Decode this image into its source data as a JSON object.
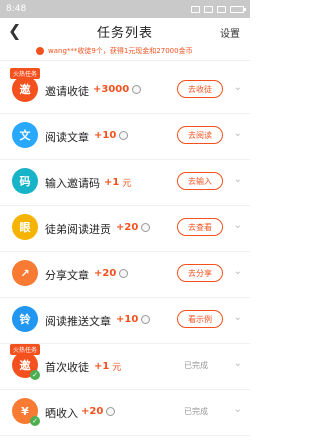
{
  "statusbar": {
    "time": "8:48"
  },
  "nav": {
    "back_icon": "back-icon",
    "title": "任务列表",
    "settings": "设置"
  },
  "ticker": {
    "text": "wang***收徒9个，获得1元现金和27000金币"
  },
  "colors": {
    "accent": "#f4511e",
    "blue": "#29a8ff",
    "teal": "#17b3c9",
    "yellow": "#f6b400",
    "orange": "#f97a33",
    "sky": "#2196f3"
  },
  "tasks": [
    {
      "label": "邀请收徒",
      "reward": "+3000",
      "unit": "",
      "coin": true,
      "action": "去收徒",
      "hot": "火热任务",
      "done": ""
    },
    {
      "label": "阅读文章",
      "reward": "+10",
      "unit": "",
      "coin": true,
      "action": "去阅读",
      "hot": "",
      "done": ""
    },
    {
      "label": "输入邀请码",
      "reward": "+1",
      "unit": "元",
      "coin": false,
      "action": "去输入",
      "hot": "",
      "done": ""
    },
    {
      "label": "徒弟阅读进贡",
      "reward": "+20",
      "unit": "",
      "coin": true,
      "action": "去查看",
      "hot": "",
      "done": ""
    },
    {
      "label": "分享文章",
      "reward": "+20",
      "unit": "",
      "coin": true,
      "action": "去分享",
      "hot": "",
      "done": ""
    },
    {
      "label": "阅读推送文章",
      "reward": "+10",
      "unit": "",
      "coin": true,
      "action": "看示例",
      "hot": "",
      "done": ""
    },
    {
      "label": "首次收徒",
      "reward": "+1",
      "unit": "元",
      "coin": false,
      "action": "",
      "hot": "火热任务",
      "done": "已完成"
    },
    {
      "label": "晒收入",
      "reward": "+20",
      "unit": "",
      "coin": true,
      "action": "",
      "hot": "",
      "done": "已完成"
    }
  ]
}
